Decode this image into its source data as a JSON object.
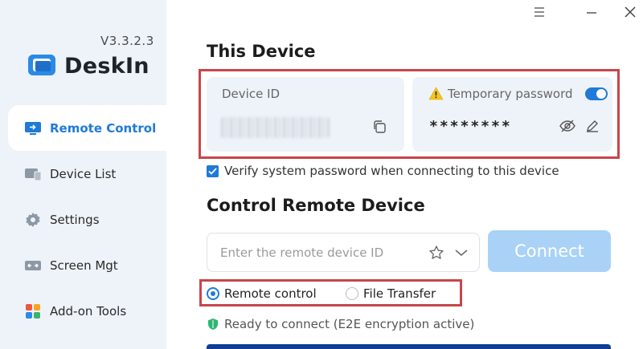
{
  "app": {
    "version": "V3.3.2.3",
    "name": "DeskIn",
    "brand_color": "#1f7ad8"
  },
  "sidebar": {
    "items": [
      {
        "label": "Remote Control",
        "icon": "remote-control-icon",
        "active": true
      },
      {
        "label": "Device List",
        "icon": "device-list-icon",
        "active": false
      },
      {
        "label": "Settings",
        "icon": "gear-icon",
        "active": false
      },
      {
        "label": "Screen Mgt",
        "icon": "screen-mgt-icon",
        "active": false
      },
      {
        "label": "Add-on Tools",
        "icon": "addon-tools-icon",
        "active": false
      }
    ]
  },
  "window_controls": [
    "menu-icon",
    "minimize-icon",
    "close-icon"
  ],
  "this_device": {
    "title": "This Device",
    "device_id_label": "Device ID",
    "device_id_value": "",
    "temp_password_label": "Temporary password",
    "temp_password_value": "********",
    "temp_password_enabled": true,
    "verify_label": "Verify system password when connecting to this device",
    "verify_checked": true
  },
  "control_remote": {
    "title": "Control Remote Device",
    "input_placeholder": "Enter the remote device ID",
    "input_value": "",
    "connect_label": "Connect",
    "modes": [
      {
        "label": "Remote control",
        "selected": true
      },
      {
        "label": "File Transfer",
        "selected": false
      }
    ],
    "status_text": "Ready to connect (E2E encryption active)"
  }
}
